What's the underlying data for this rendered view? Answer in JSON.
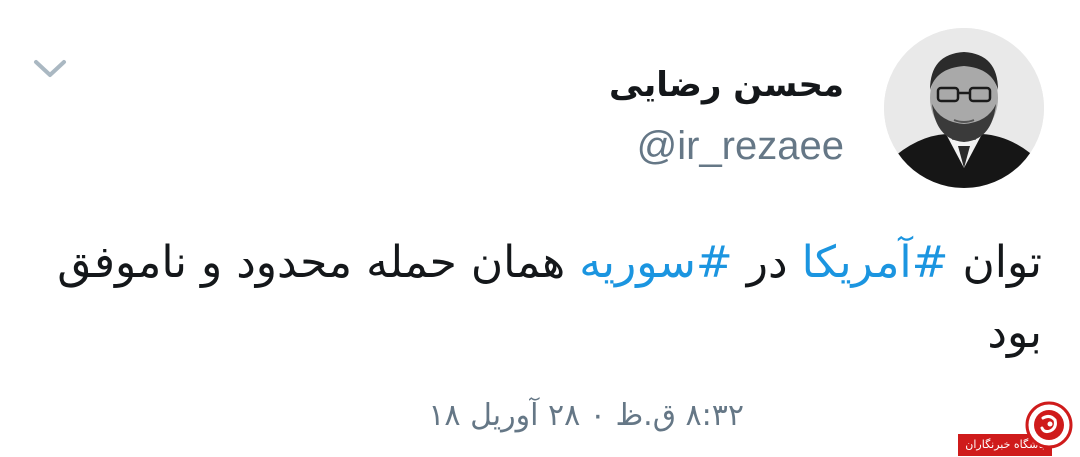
{
  "user": {
    "display_name": "محسن رضایی",
    "handle": "@ir_rezaee",
    "avatar_icon": "profile-photo"
  },
  "tweet": {
    "text": {
      "part1": "توان ",
      "hashtag1": "#آمریکا",
      "part2": " در ",
      "hashtag2": "#سوریه",
      "part3": " همان حمله محدود و ناموفق بود"
    },
    "timestamp": "۸:۳۲ ق.ظ ۰ ۲۸ آوریل ۱۸",
    "hashtag_color": "#1b95e0"
  },
  "menu": {
    "icon": "chevron-down-icon"
  },
  "watermark": {
    "label": "باشگاه خبرنگاران",
    "accent_color": "#cf1b1b"
  }
}
